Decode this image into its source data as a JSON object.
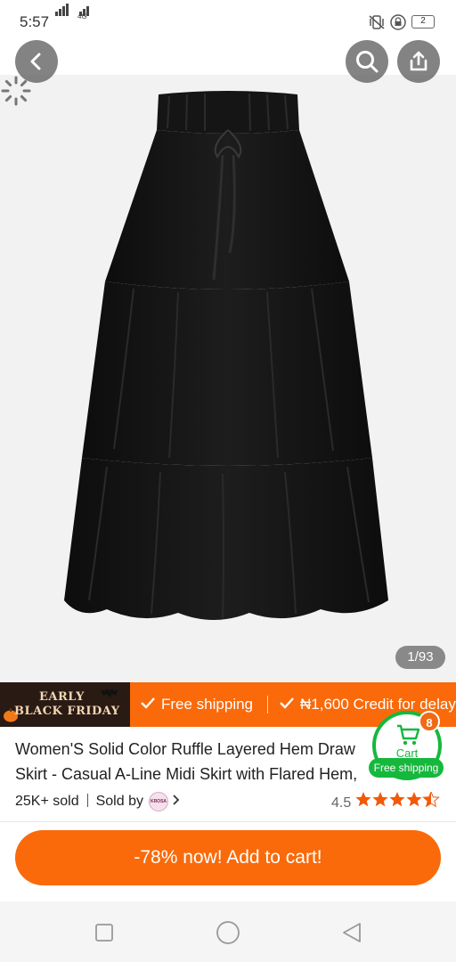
{
  "status_bar": {
    "time": "5:57",
    "network": "4G",
    "notifications": "2"
  },
  "gallery": {
    "counter": "1/93",
    "icons": [
      "back-arrow-icon",
      "search-icon",
      "share-icon",
      "loading-spinner-icon"
    ]
  },
  "promo": {
    "badge_line1": "EARLY",
    "badge_line2": "BLACK FRIDAY",
    "item1": "Free shipping",
    "item2": "₦1,600 Credit for delay"
  },
  "product": {
    "title_line1": "Women'S Solid Color Ruffle Layered Hem Draw",
    "title_line2": "Skirt - Casual A-Line Midi Skirt with Flared Hem,",
    "sold": "25K+ sold",
    "sold_by": "Sold by",
    "seller_logo_text": "KROSA",
    "rating": "4.5",
    "rating_stars": 4.5
  },
  "cart": {
    "label": "Cart",
    "count": "8",
    "shipping": "Free shipping"
  },
  "cta": {
    "label": "-78% now! Add to cart!"
  },
  "colors": {
    "accent": "#fa6a0a",
    "cart_green": "#15b83d",
    "badge_dark": "#2a1a14"
  }
}
